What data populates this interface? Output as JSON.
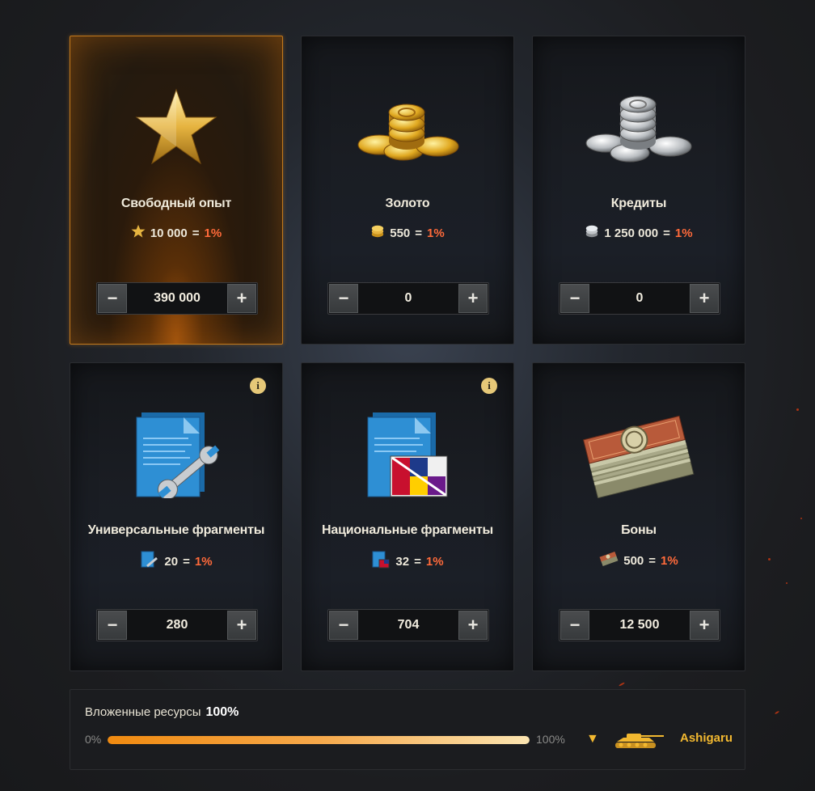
{
  "resources": [
    {
      "title": "Свободный опыт",
      "rate_amount": "10 000",
      "rate_pct": "1%",
      "value": "390 000",
      "selected": true,
      "icon": "free-xp-star-icon",
      "info": false
    },
    {
      "title": "Золото",
      "rate_amount": "550",
      "rate_pct": "1%",
      "value": "0",
      "selected": false,
      "icon": "gold-coins-icon",
      "info": false
    },
    {
      "title": "Кредиты",
      "rate_amount": "1 250 000",
      "rate_pct": "1%",
      "value": "0",
      "selected": false,
      "icon": "credits-coins-icon",
      "info": false
    },
    {
      "title": "Универсальные фрагменты",
      "rate_amount": "20",
      "rate_pct": "1%",
      "value": "280",
      "selected": false,
      "icon": "universal-blueprint-icon",
      "info": true
    },
    {
      "title": "Национальные фрагменты",
      "rate_amount": "32",
      "rate_pct": "1%",
      "value": "704",
      "selected": false,
      "icon": "national-blueprint-icon",
      "info": true
    },
    {
      "title": "Боны",
      "rate_amount": "500",
      "rate_pct": "1%",
      "value": "12 500",
      "selected": false,
      "icon": "bonds-icon",
      "info": false
    }
  ],
  "stepper": {
    "minus": "−",
    "plus": "+"
  },
  "info_symbol": "i",
  "equals": "=",
  "summary": {
    "label": "Вложенные ресурсы",
    "value": "100%",
    "min_label": "0%",
    "max_label": "100%",
    "progress_fraction": 1.0,
    "player_name": "Ashigaru",
    "marker": "▼"
  },
  "colors": {
    "accent": "#f2b830",
    "percent": "#ff6a3a",
    "selected_border": "#c47a1c"
  }
}
